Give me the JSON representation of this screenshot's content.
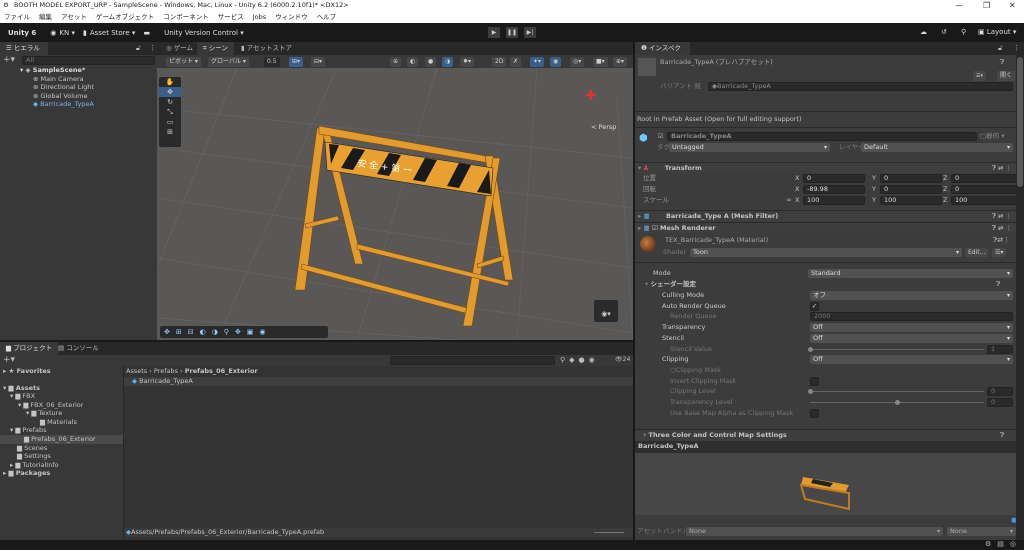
{
  "window": {
    "title": "BOOTH MODEL EXPORT_URP - SampleScene - Windows, Mac, Linux - Unity 6.2 (6000.2.10f1)* <DX12>"
  },
  "menu": [
    "ファイル",
    "編集",
    "アセット",
    "ゲームオブジェクト",
    "コンポーネント",
    "サービス",
    "Jobs",
    "ウィンドウ",
    "ヘルプ"
  ],
  "toolbar": {
    "unity": "Unity 6",
    "account": "KN ▾",
    "asset_store": "Asset Store ▾",
    "version_control": "Unity Version Control ▾",
    "layout": "Layout ▾"
  },
  "hierarchy": {
    "tab": "ヒエラルキー",
    "search_placeholder": "All",
    "scene": "SampleScene*",
    "items": [
      "Main Camera",
      "Directional Light",
      "Global Volume",
      "Barricade_TypeA"
    ]
  },
  "scene_tabs": [
    "ゲーム",
    "シーン",
    "アセットストア"
  ],
  "scene_toolbar": {
    "pivot": "ピボット ▾",
    "global": "グローバル ▾",
    "snap": "0.5",
    "persp": "< Persp"
  },
  "barricade_text": "安 全 + 第 一",
  "project": {
    "tabs": [
      "プロジェクト",
      "コンソール"
    ],
    "favorites": "Favorites",
    "tree": [
      "Assets",
      "FBX",
      "FBX_06_Exterior",
      "Texture",
      "Materials",
      "Prefabs",
      "Prefabs_06_Exterior",
      "Scenes",
      "Settings",
      "TutorialInfo",
      "Packages"
    ],
    "breadcrumb": [
      "Assets",
      "Prefabs",
      "Prefabs_06_Exterior"
    ],
    "file": "Barricade_TypeA",
    "count": "24",
    "path": "Assets/Prefabs/Prefabs_06_Exterior/Barricade_TypeA.prefab"
  },
  "inspector": {
    "tab": "インスペクター",
    "title": "Barricade_TypeA (プレハブアセット)",
    "open": "開く",
    "variant_label": "バリアント 親",
    "variant_value": "Barricade_TypeA",
    "root_note": "Root in Prefab Asset (Open for full editing support)",
    "name": "Barricade_TypeA",
    "static": "静的",
    "tag_label": "タグ",
    "tag": "Untagged",
    "layer_label": "レイヤー",
    "layer": "Default",
    "transform": {
      "title": "Transform",
      "rows": [
        {
          "label": "位置",
          "x": "0",
          "y": "0",
          "z": "0"
        },
        {
          "label": "回転",
          "x": "-89.98",
          "y": "0",
          "z": "0"
        },
        {
          "label": "スケール",
          "x": "100",
          "y": "100",
          "z": "100"
        }
      ]
    },
    "mesh_filter": "Barricade_Type A (Mesh Filter)",
    "mesh_renderer": "Mesh Renderer",
    "material": "TEX_Barricade_TypeA (Material)",
    "shader_label": "Shader",
    "shader": "Toon",
    "edit": "Edit...",
    "mode_label": "Mode",
    "mode": "Standard",
    "shader_settings": "シェーダー設定",
    "props": [
      {
        "label": "Culling Mode",
        "value": "オフ",
        "type": "drop"
      },
      {
        "label": "Auto Render Queue",
        "value": "✓",
        "type": "check"
      },
      {
        "label": "Render Queue",
        "value": "2000",
        "type": "fielddim"
      },
      {
        "label": "Transparency",
        "value": "Off",
        "type": "drop"
      },
      {
        "label": "Stencil",
        "value": "Off",
        "type": "drop"
      },
      {
        "label": "Stencil Value",
        "value": "1",
        "type": "slider0"
      },
      {
        "label": "Clipping",
        "value": "Off",
        "type": "drop"
      },
      {
        "label": "○Clipping Mask",
        "value": "",
        "type": "none"
      },
      {
        "label": "Invert Clipping Mask",
        "value": "",
        "type": "checkdim"
      },
      {
        "label": "Clipping Level",
        "value": "0",
        "type": "slider0"
      },
      {
        "label": "Transparency Level",
        "value": "0",
        "type": "slider50"
      },
      {
        "label": "Use Base Map Alpha as Clipping Mask",
        "value": "",
        "type": "checkdim"
      }
    ],
    "three_color": "Three Color and Control Map Settings",
    "preview_title": "Barricade_TypeA",
    "asset_bundle_label": "アセットバンドル",
    "bundle": "None",
    "variant": "None"
  },
  "colors": {
    "accent": "#4a8fe0",
    "barricade": "#e8a030"
  }
}
